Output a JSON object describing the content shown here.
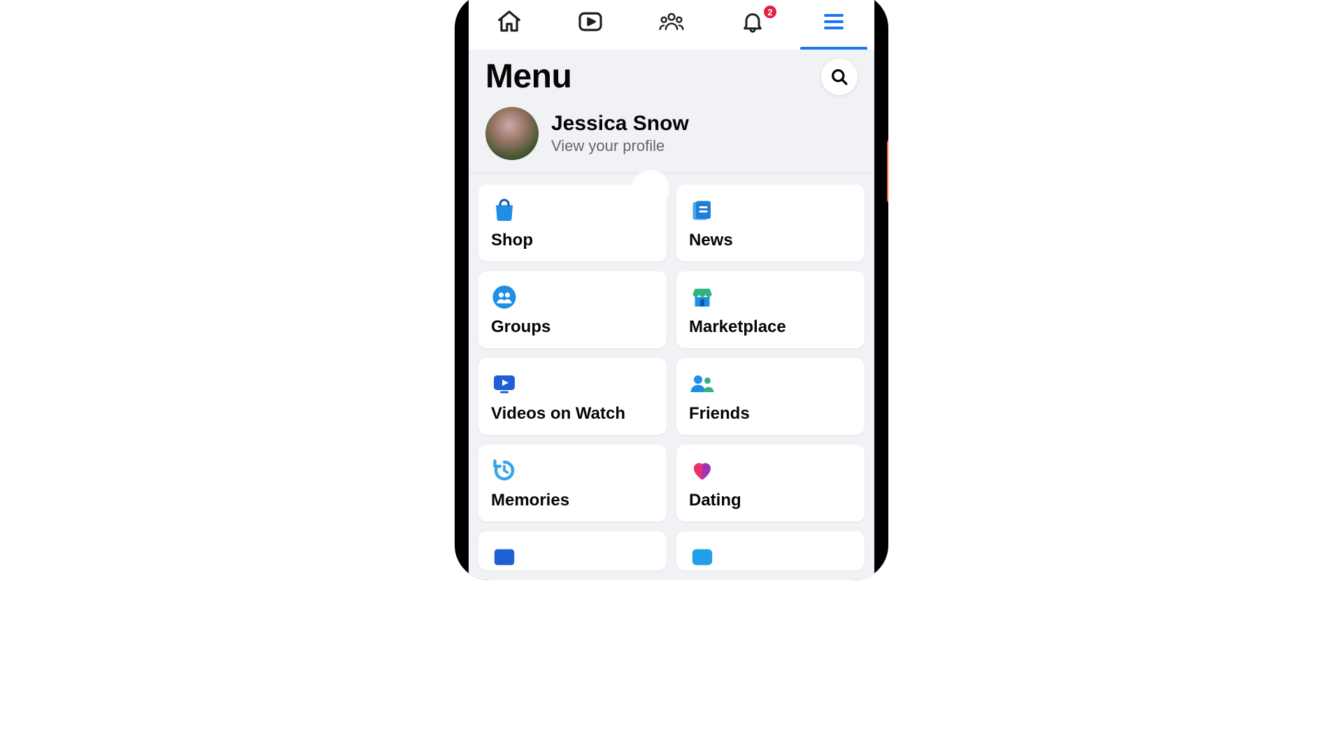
{
  "topbar": {
    "tabs": [
      "home",
      "watch",
      "groups",
      "notifications",
      "menu"
    ],
    "active_tab": "menu",
    "notification_badge": 2
  },
  "header": {
    "title": "Menu"
  },
  "profile": {
    "name": "Jessica Snow",
    "subtitle": "View your profile"
  },
  "shortcuts": [
    {
      "id": "shop",
      "label": "Shop"
    },
    {
      "id": "news",
      "label": "News"
    },
    {
      "id": "groups",
      "label": "Groups"
    },
    {
      "id": "marketplace",
      "label": "Marketplace"
    },
    {
      "id": "videos",
      "label": "Videos on Watch"
    },
    {
      "id": "friends",
      "label": "Friends"
    },
    {
      "id": "memories",
      "label": "Memories"
    },
    {
      "id": "dating",
      "label": "Dating"
    }
  ],
  "colors": {
    "accent": "#1877f2",
    "badge": "#e41e3f"
  }
}
